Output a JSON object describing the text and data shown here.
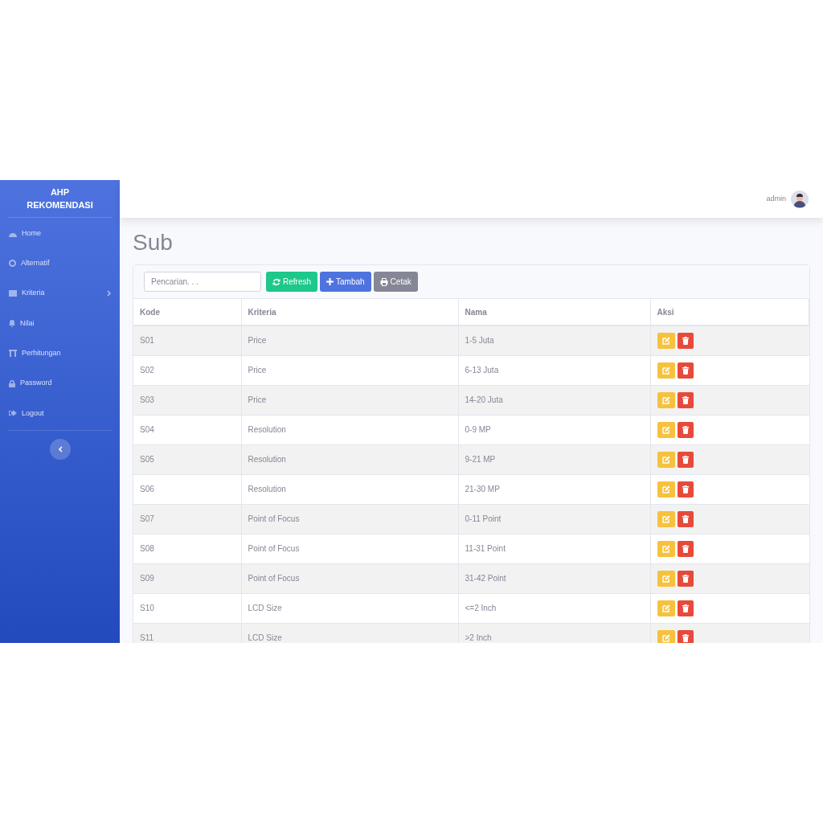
{
  "sidebar": {
    "brand": "AHP REKOMENDASI",
    "items": [
      {
        "label": "Home",
        "has_submenu": false
      },
      {
        "label": "Alternatif",
        "has_submenu": false
      },
      {
        "label": "Kriteria",
        "has_submenu": true
      },
      {
        "label": "Nilai",
        "has_submenu": false
      },
      {
        "label": "Perhitungan",
        "has_submenu": false
      },
      {
        "label": "Password",
        "has_submenu": false
      },
      {
        "label": "Logout",
        "has_submenu": false
      }
    ]
  },
  "topbar": {
    "user": "admin"
  },
  "page_title": "Sub",
  "toolbar": {
    "search": {
      "placeholder": "Pencarian. . ."
    },
    "buttons": [
      {
        "label": "Refresh",
        "kind": "refresh"
      },
      {
        "label": "Tambah",
        "kind": "add"
      },
      {
        "label": "Cetak",
        "kind": "print"
      }
    ]
  },
  "table": {
    "columns": [
      "Kode",
      "Kriteria",
      "Nama",
      "Aksi"
    ],
    "rows": [
      {
        "kode": "S01",
        "kriteria": "Price",
        "nama": "1-5 Juta"
      },
      {
        "kode": "S02",
        "kriteria": "Price",
        "nama": "6-13 Juta"
      },
      {
        "kode": "S03",
        "kriteria": "Price",
        "nama": "14-20 Juta"
      },
      {
        "kode": "S04",
        "kriteria": "Resolution",
        "nama": "0-9 MP"
      },
      {
        "kode": "S05",
        "kriteria": "Resolution",
        "nama": "9-21 MP"
      },
      {
        "kode": "S06",
        "kriteria": "Resolution",
        "nama": "21-30 MP"
      },
      {
        "kode": "S07",
        "kriteria": "Point of Focus",
        "nama": "0-11 Point"
      },
      {
        "kode": "S08",
        "kriteria": "Point of Focus",
        "nama": "11-31 Point"
      },
      {
        "kode": "S09",
        "kriteria": "Point of Focus",
        "nama": "31-42 Point"
      },
      {
        "kode": "S10",
        "kriteria": "LCD Size",
        "nama": "<=2 Inch"
      },
      {
        "kode": "S11",
        "kriteria": "LCD Size",
        "nama": ">2 Inch"
      }
    ]
  }
}
